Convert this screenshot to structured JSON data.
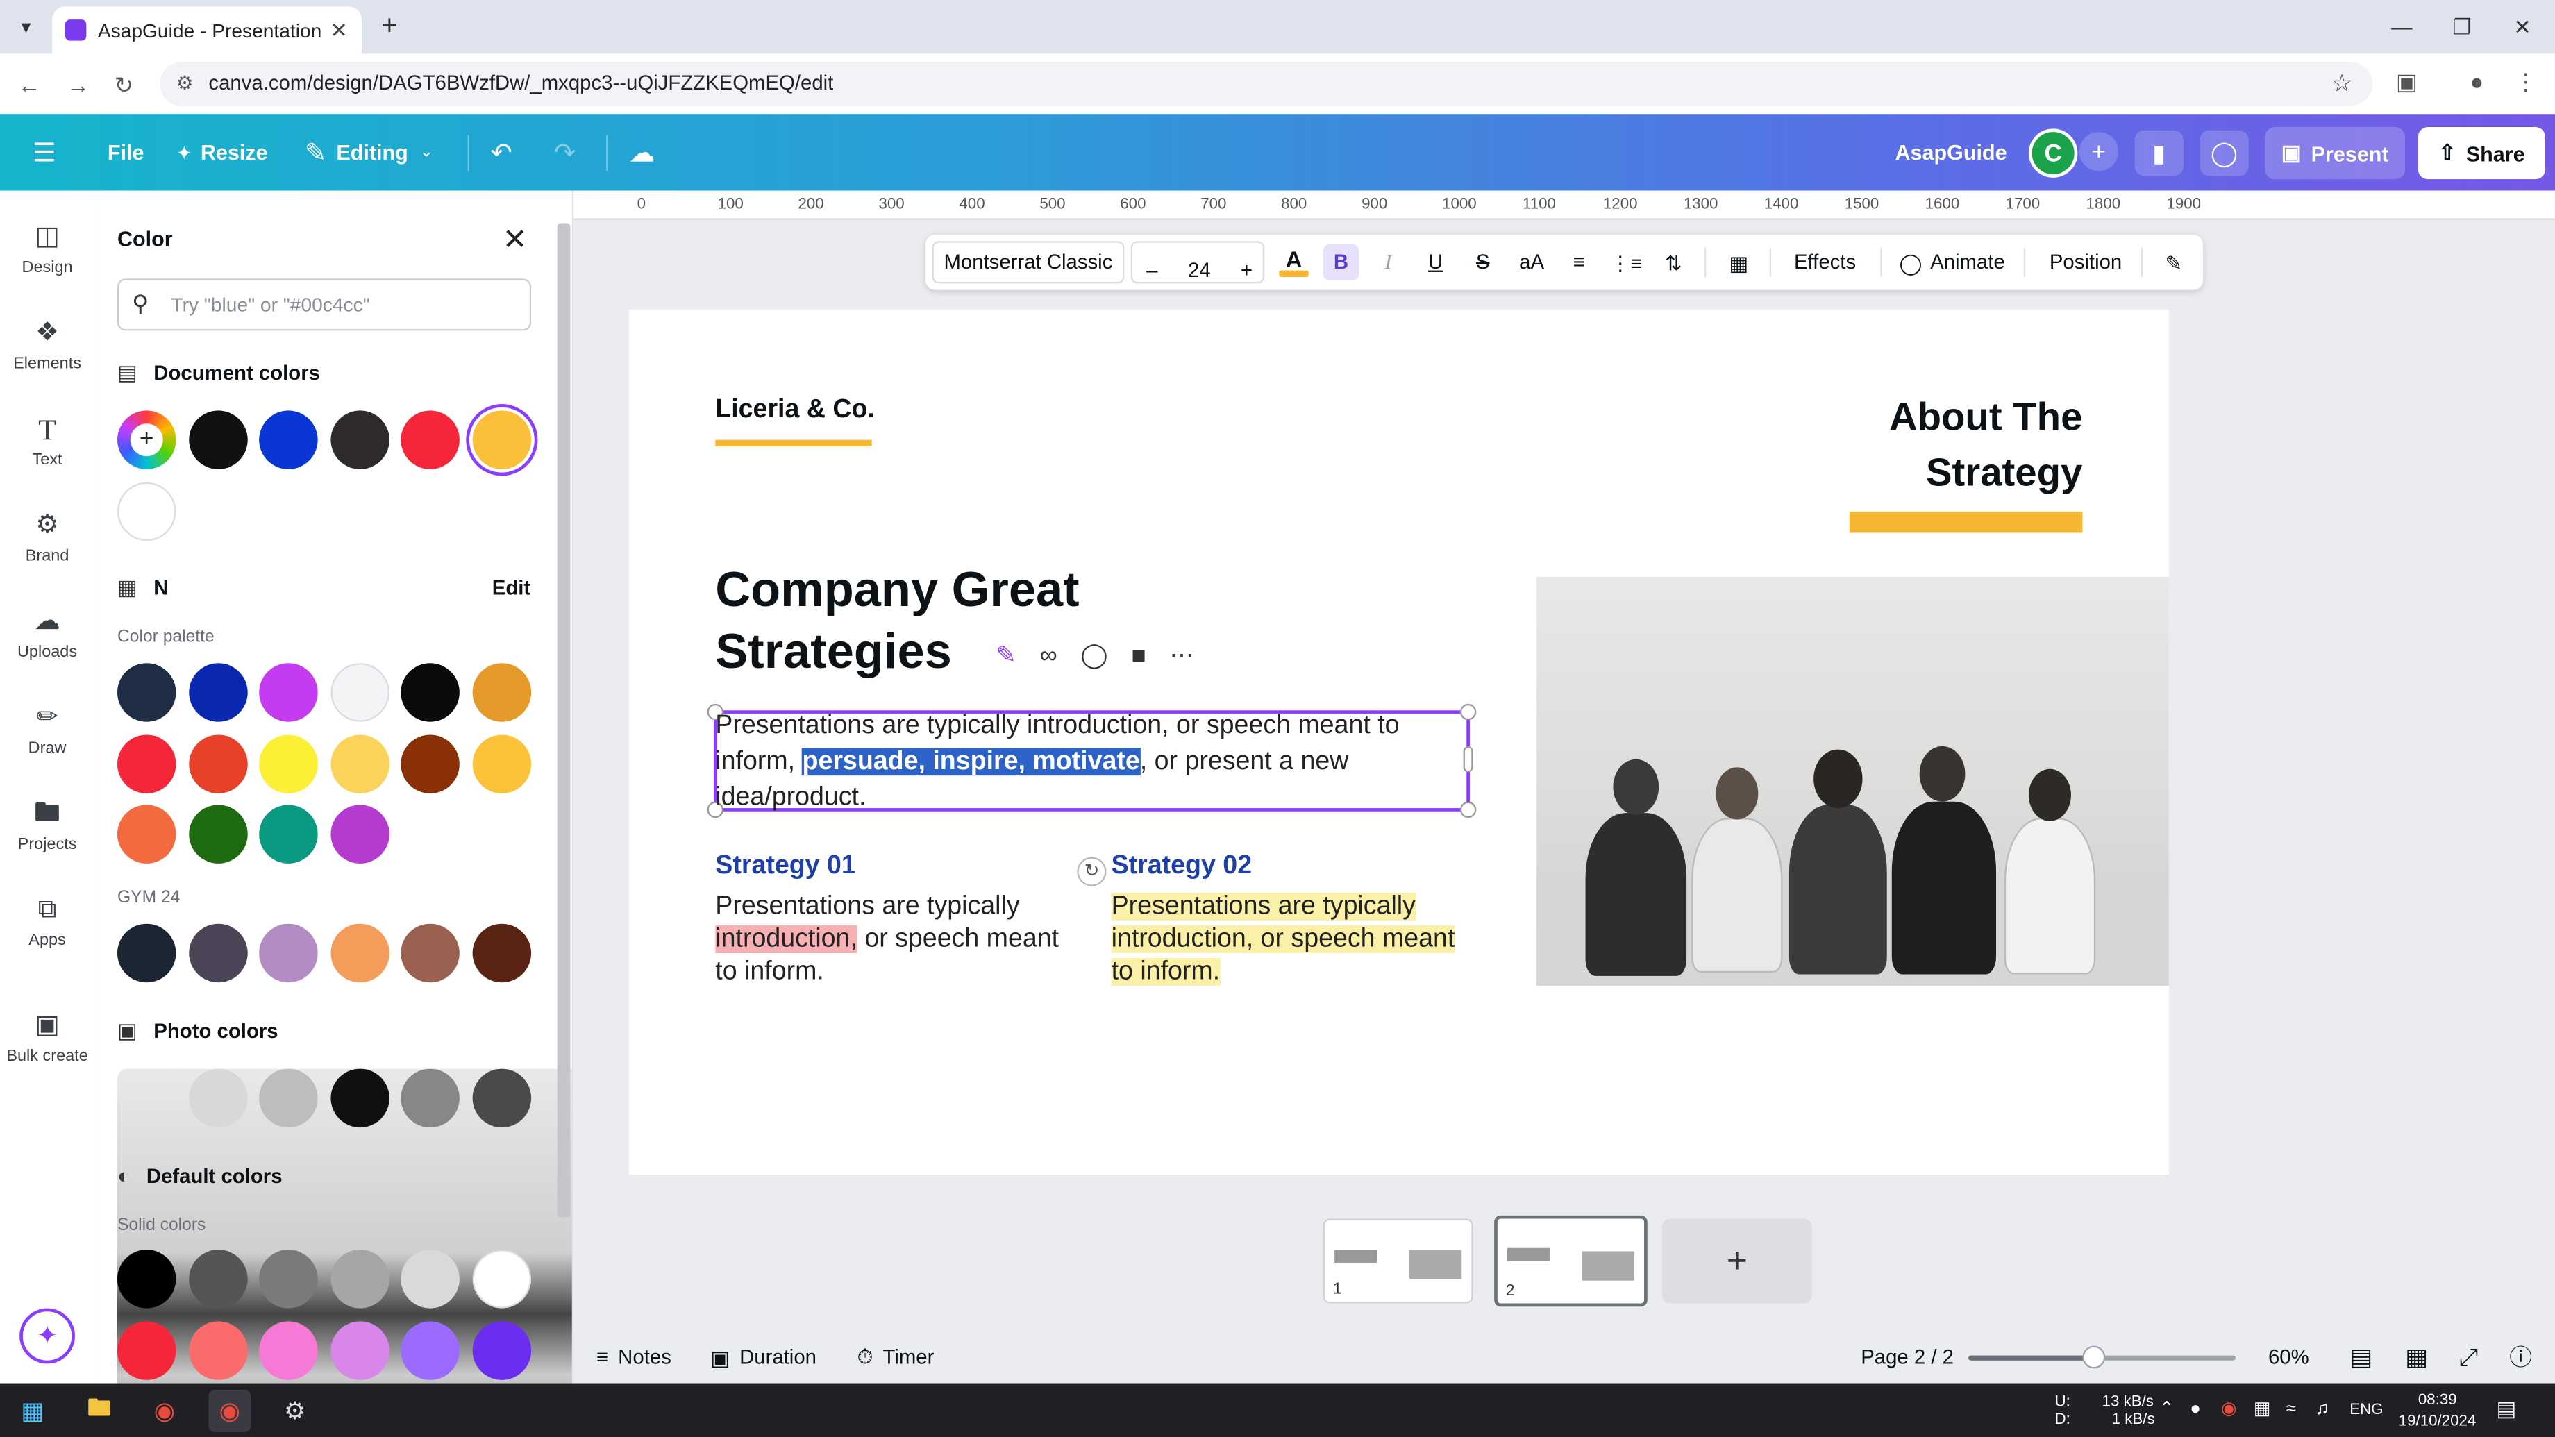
{
  "browser": {
    "tab_title": "AsapGuide - Presentation",
    "url": "canva.com/design/DAGT6BWzfDw/_mxqpc3--uQiJFZZKEQmEQ/edit"
  },
  "topbar": {
    "file": "File",
    "resize": "Resize",
    "editing": "Editing",
    "team_name": "AsapGuide",
    "avatar_letter": "C",
    "present": "Present",
    "share": "Share"
  },
  "rail": {
    "items": [
      {
        "label": "Design",
        "icon": "design-icon"
      },
      {
        "label": "Elements",
        "icon": "elements-icon"
      },
      {
        "label": "Text",
        "icon": "text-icon"
      },
      {
        "label": "Brand",
        "icon": "brand-icon"
      },
      {
        "label": "Uploads",
        "icon": "uploads-icon"
      },
      {
        "label": "Draw",
        "icon": "draw-icon"
      },
      {
        "label": "Projects",
        "icon": "projects-icon"
      },
      {
        "label": "Apps",
        "icon": "apps-icon"
      },
      {
        "label": "Bulk create",
        "icon": "bulk-create-icon"
      }
    ]
  },
  "color_panel": {
    "title": "Color",
    "search_placeholder": "Try \"blue\" or \"#00c4cc\"",
    "document_colors_title": "Document colors",
    "document_colors": [
      "#111111",
      "#0a36d6",
      "#2f2b2d",
      "#f5263a",
      "#fbbf3a",
      "#ffffff"
    ],
    "brand_kit_title": "N",
    "brand_kit_edit": "Edit",
    "palette_label": "Color palette",
    "palette": [
      "#1f2d45",
      "#0a28b0",
      "#c43bf0",
      "#f4f4f6",
      "#0b0b0b",
      "#e39a2a",
      "#f5263a",
      "#e8412a",
      "#fbf035",
      "#fcd35a",
      "#8a3006",
      "#fcc23a",
      "#f26a3e",
      "#1f6b12",
      "#0a9a82",
      "#b53ad0"
    ],
    "gym_label": "GYM 24",
    "gym": [
      "#1c2633",
      "#4a4456",
      "#b38cc4",
      "#f49c5a",
      "#9b6150",
      "#5a2414"
    ],
    "photo_colors_title": "Photo colors",
    "photo_colors": [
      "#d8d8d6",
      "#bdbdbb",
      "#101010",
      "#878787",
      "#4a4a4a"
    ],
    "default_colors_title": "Default colors",
    "solid_label": "Solid colors",
    "solid": [
      "#000000",
      "#555555",
      "#7a7a7a",
      "#a6a6a6",
      "#d9d9d9",
      "#ffffff",
      "#f5263a",
      "#fb6b6b",
      "#f878d6",
      "#d986ea",
      "#9b6bff",
      "#6b2ef0"
    ]
  },
  "ruler": [
    "0",
    "100",
    "200",
    "300",
    "400",
    "500",
    "600",
    "700",
    "800",
    "900",
    "1000",
    "1100",
    "1200",
    "1300",
    "1400",
    "1500",
    "1600",
    "1700",
    "1800",
    "1900"
  ],
  "text_toolbar": {
    "font": "Montserrat Classic",
    "size": "24",
    "effects": "Effects",
    "animate": "Animate",
    "position": "Position",
    "text_color": "#f5b731"
  },
  "slide": {
    "brand": "Liceria & Co.",
    "about_line1": "About The",
    "about_line2": "Strategy",
    "headline_line1": "Company Great",
    "headline_line2": "Strategies",
    "body_before": "Presentations are typically introduction, or speech meant to inform, ",
    "body_selected": "persuade, inspire, motivate",
    "body_after": ", or present a new idea/product.",
    "strategy1_title": "Strategy 01",
    "strategy1_plain1": "Presentations are typically ",
    "strategy1_hl": "introduction,",
    "strategy1_plain2": " or speech meant to inform.",
    "strategy2_title": "Strategy 02",
    "strategy2_text": "Presentations are typically introduction, or speech meant to inform.",
    "accent": "#f5b731",
    "strategy_title_color": "#1f3fa8"
  },
  "pages": {
    "thumb1": "1",
    "thumb2": "2",
    "add": "+"
  },
  "footer": {
    "notes": "Notes",
    "duration": "Duration",
    "timer": "Timer",
    "page_indicator": "Page 2 / 2",
    "zoom": "60%",
    "zoom_fraction": 0.47
  },
  "taskbar": {
    "net_up_label": "U:",
    "net_down_label": "D:",
    "net_up": "13 kB/s",
    "net_down": "1 kB/s",
    "lang": "ENG",
    "time": "08:39",
    "date": "19/10/2024"
  }
}
